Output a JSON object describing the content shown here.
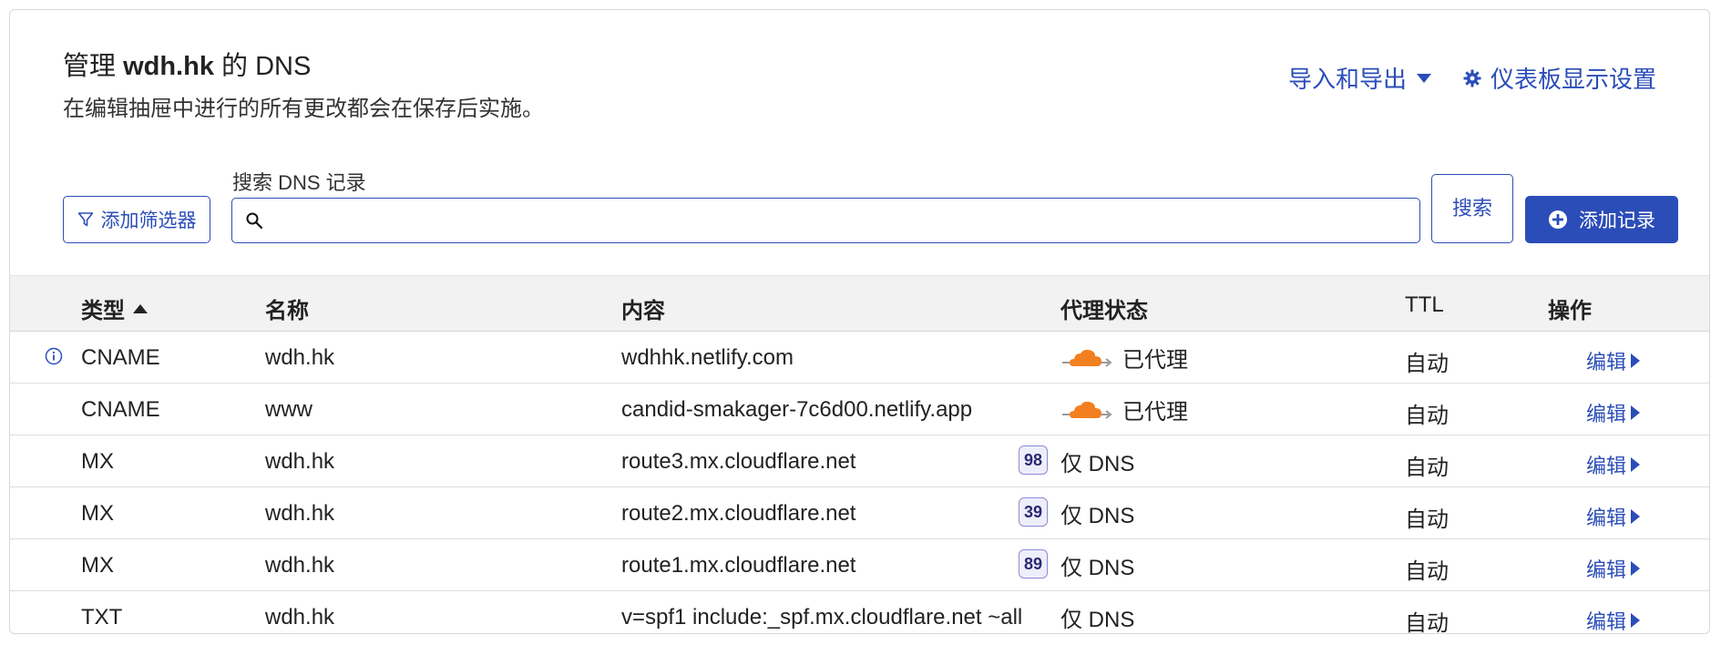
{
  "header": {
    "title_prefix": "管理 ",
    "domain": "wdh.hk",
    "title_suffix": " 的 DNS",
    "subtitle": "在编辑抽屉中进行的所有更改都会在保存后实施。",
    "import_export_label": "导入和导出",
    "dashboard_settings_label": "仪表板显示设置"
  },
  "toolbar": {
    "filter_label": "添加筛选器",
    "search_label": "搜索 DNS 记录",
    "search_value": "",
    "search_button": "搜索",
    "add_record_label": "添加记录"
  },
  "table": {
    "headers": {
      "type": "类型",
      "name": "名称",
      "content": "内容",
      "proxy": "代理状态",
      "ttl": "TTL",
      "actions": "操作"
    },
    "rows": [
      {
        "type": "CNAME",
        "name": "wdh.hk",
        "content": "wdhhk.netlify.com",
        "priority": "",
        "proxy": "已代理",
        "proxied": true,
        "ttl": "自动",
        "edit": "编辑",
        "info": true
      },
      {
        "type": "CNAME",
        "name": "www",
        "content": "candid-smakager-7c6d00.netlify.app",
        "priority": "",
        "proxy": "已代理",
        "proxied": true,
        "ttl": "自动",
        "edit": "编辑",
        "info": false
      },
      {
        "type": "MX",
        "name": "wdh.hk",
        "content": "route3.mx.cloudflare.net",
        "priority": "98",
        "proxy": "仅 DNS",
        "proxied": false,
        "ttl": "自动",
        "edit": "编辑",
        "info": false
      },
      {
        "type": "MX",
        "name": "wdh.hk",
        "content": "route2.mx.cloudflare.net",
        "priority": "39",
        "proxy": "仅 DNS",
        "proxied": false,
        "ttl": "自动",
        "edit": "编辑",
        "info": false
      },
      {
        "type": "MX",
        "name": "wdh.hk",
        "content": "route1.mx.cloudflare.net",
        "priority": "89",
        "proxy": "仅 DNS",
        "proxied": false,
        "ttl": "自动",
        "edit": "编辑",
        "info": false
      },
      {
        "type": "TXT",
        "name": "wdh.hk",
        "content": "v=spf1 include:_spf.mx.cloudflare.net ~all",
        "priority": "",
        "proxy": "仅 DNS",
        "proxied": false,
        "ttl": "自动",
        "edit": "编辑",
        "info": false
      }
    ]
  },
  "colors": {
    "accent": "#2b4db8",
    "cloud": "#f38020"
  }
}
